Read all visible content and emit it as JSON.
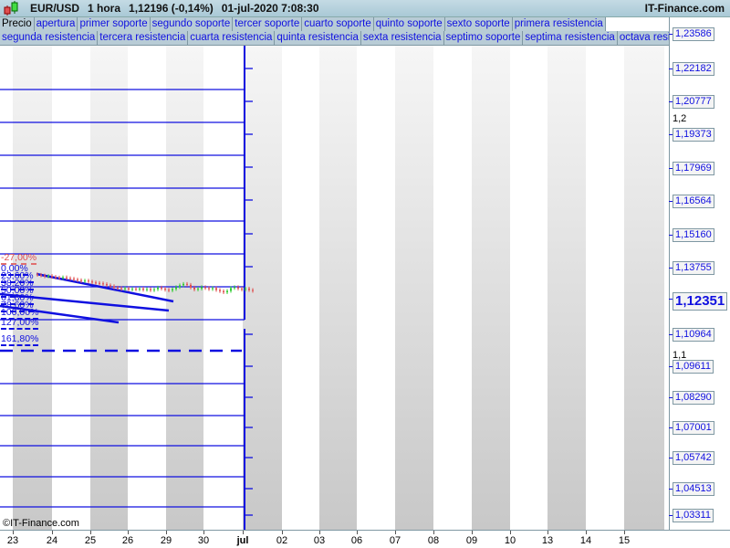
{
  "header": {
    "symbol": "EUR/USD",
    "timeframe": "1 hora",
    "price": "1,12196 (-0,14%)",
    "datetime": "01-jul-2020 7:08:30",
    "brand": "IT-Finance.com"
  },
  "tabs_row1": [
    "Precio",
    "apertura",
    "primer soporte",
    "segundo soporte",
    "tercer soporte",
    "cuarto soporte",
    "quinto soporte",
    "sexto soporte",
    "primera resistencia"
  ],
  "tabs_row2": [
    "segunda resistencia",
    "tercera resistencia",
    "cuarta resistencia",
    "quinta resistencia",
    "sexta resistencia",
    "septimo soporte",
    "septima resistencia",
    "octava resistencia"
  ],
  "axis": {
    "levels": [
      "1,23586",
      "1,22182",
      "1,20777",
      "1,19373",
      "1,17969",
      "1,16564",
      "1,15160",
      "1,13755",
      "1,12351",
      "1,10964",
      "1,09611",
      "1,08290",
      "1,07001",
      "1,05742",
      "1,04513",
      "1,03311"
    ],
    "current": "1,12351",
    "round_labels": [
      "1,2",
      "1,1"
    ]
  },
  "fib_labels": [
    "-27,00%",
    "0,00%",
    "23,60%",
    "38,20%",
    "50,00%",
    "61,80%",
    "78,60%",
    "100,00%",
    "127,00%",
    "161,80%"
  ],
  "dates": [
    "23",
    "24",
    "25",
    "26",
    "29",
    "30",
    "jul",
    "02",
    "03",
    "06",
    "07",
    "08",
    "09",
    "10",
    "13",
    "14",
    "15"
  ],
  "copyright": "©IT-Finance.com",
  "colors": {
    "up": "#33cc33",
    "down": "#e05050",
    "line": "#1010e0"
  },
  "chart_data": {
    "type": "candlestick",
    "closes": [
      1.1345,
      1.1342,
      1.1338,
      1.134,
      1.1336,
      1.1333,
      1.1331,
      1.1334,
      1.133,
      1.1328,
      1.1325,
      1.1322,
      1.1318,
      1.132,
      1.1316,
      1.1312,
      1.131,
      1.1308,
      1.1305,
      1.13,
      1.1296,
      1.129,
      1.1288,
      1.1284,
      1.1287,
      1.1282,
      1.1285,
      1.1283,
      1.1286,
      1.1281,
      1.1284,
      1.1279,
      1.1283,
      1.129,
      1.1286,
      1.1281,
      1.1278,
      1.1284,
      1.1292,
      1.13,
      1.1306,
      1.1302,
      1.129,
      1.1282,
      1.1286,
      1.1292,
      1.1288,
      1.1284,
      1.1288,
      1.128,
      1.1275,
      1.127,
      1.1276,
      1.1288,
      1.1292,
      1.1286,
      1.1282,
      1.1286,
      1.128,
      1.1276
    ]
  }
}
